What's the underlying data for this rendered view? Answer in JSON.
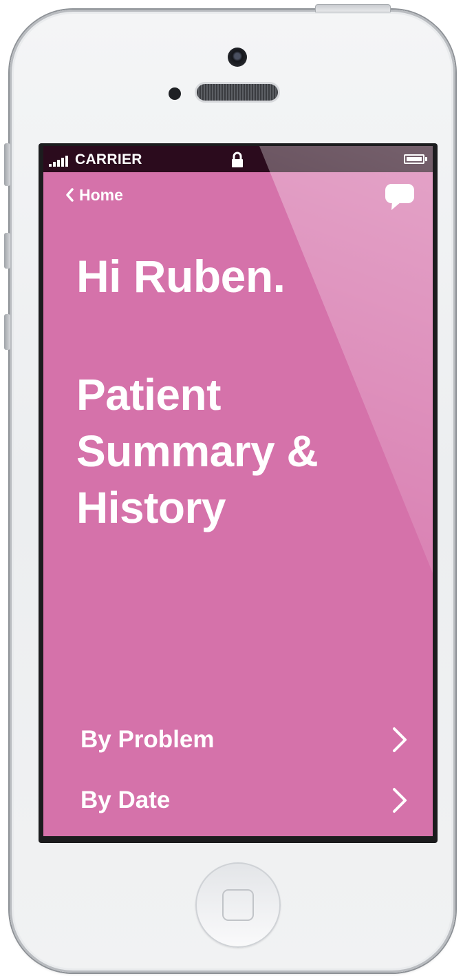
{
  "status_bar": {
    "carrier": "CARRIER"
  },
  "nav": {
    "back_label": "Home"
  },
  "main": {
    "greeting": "Hi Ruben.",
    "title_lines": [
      "Patient",
      "Summary &",
      "History"
    ]
  },
  "menu": [
    {
      "label": "By Problem"
    },
    {
      "label": "By Date"
    }
  ],
  "colors": {
    "accent": "#d572aa",
    "status_bar": "#2b0b1d"
  }
}
